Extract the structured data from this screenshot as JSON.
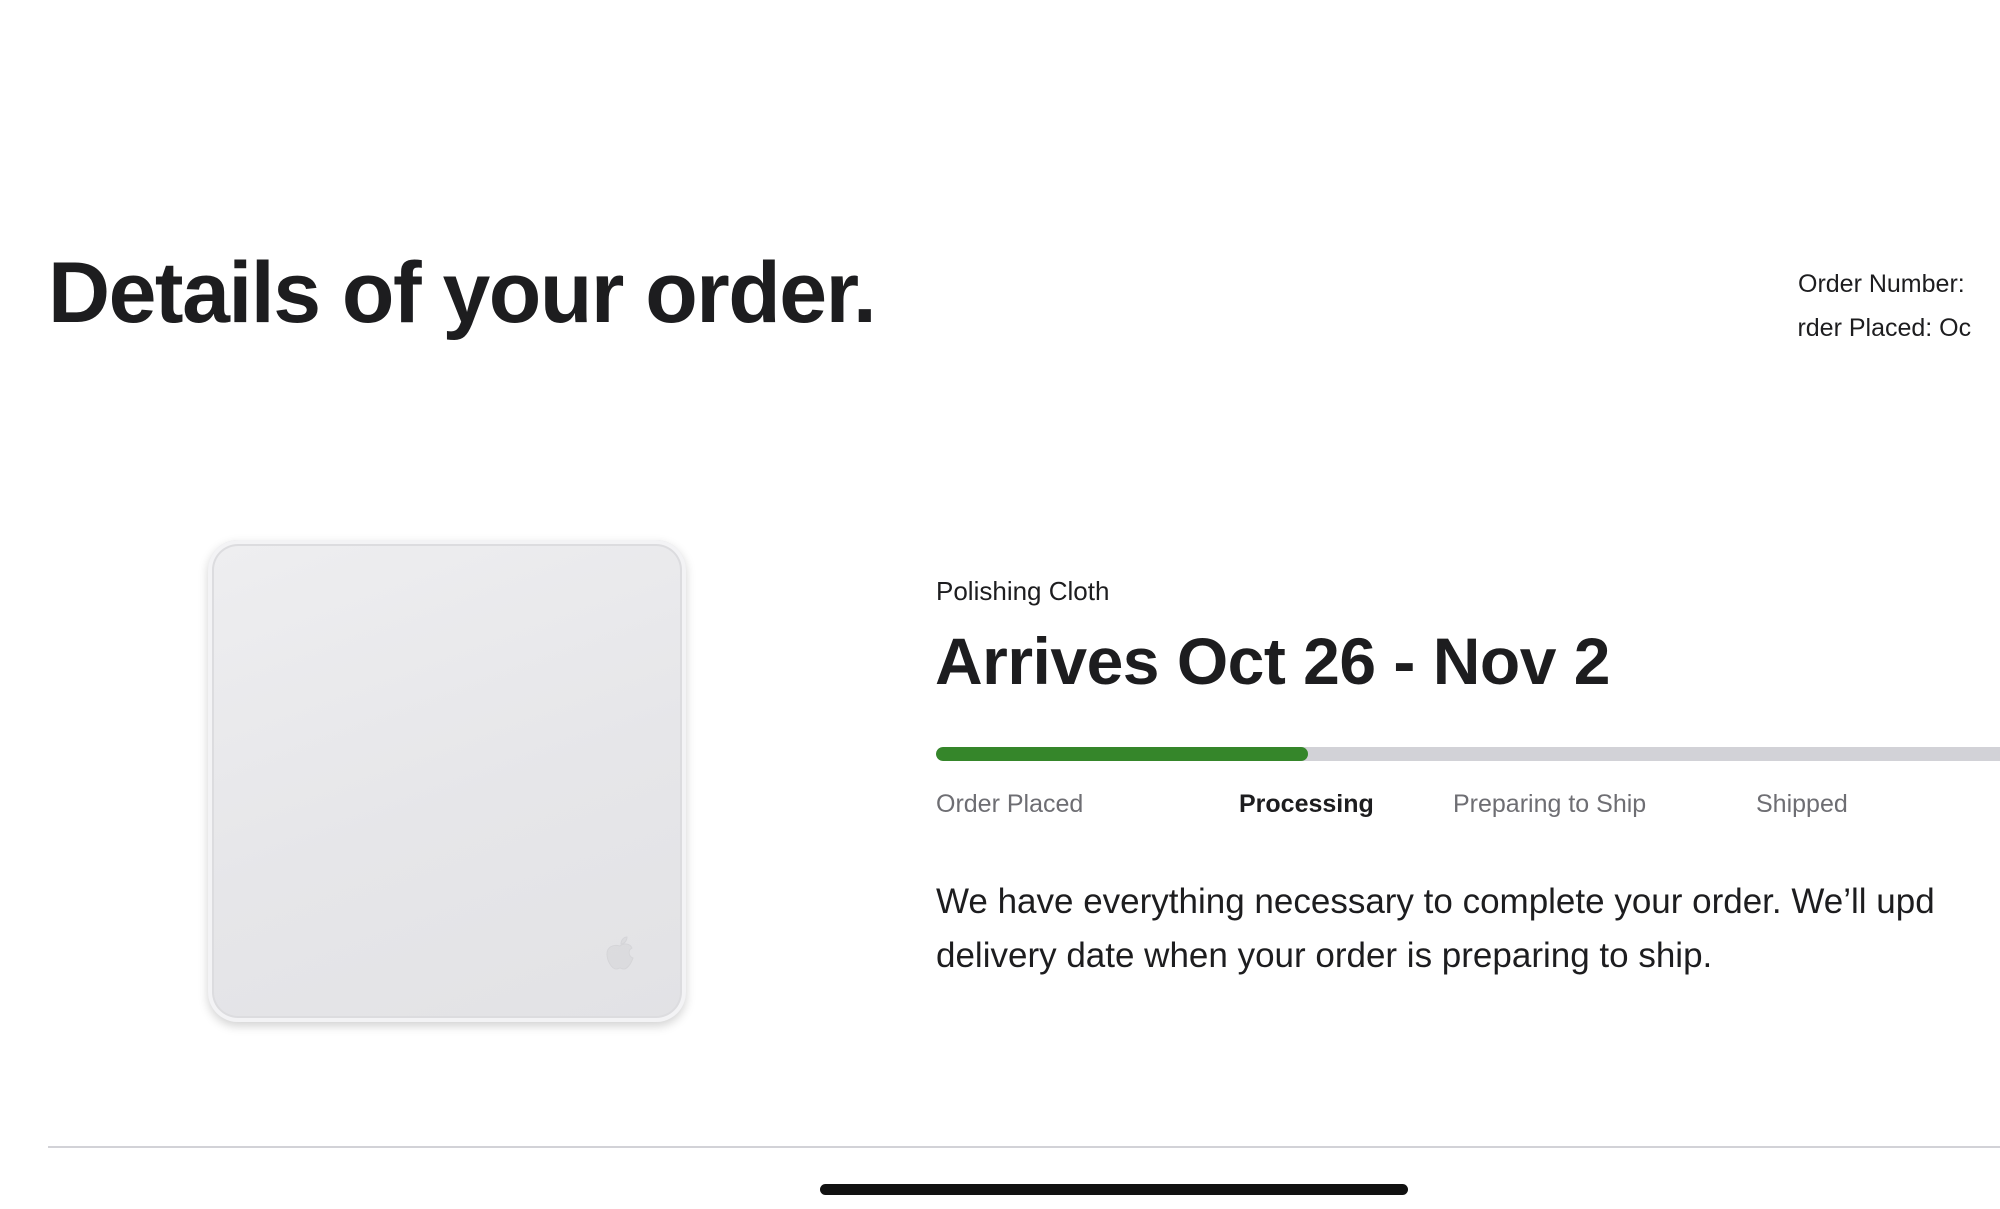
{
  "header": {
    "title": "Details of your order.",
    "order_number_label": "Order Number:",
    "order_placed_label": "Order Placed: Oc"
  },
  "item": {
    "name": "Polishing Cloth",
    "arrival": "Arrives Oct 26 - Nov 2",
    "image_icon": "apple-logo-icon"
  },
  "progress": {
    "fraction": 0.35,
    "fill_color": "#35862a",
    "track_color": "#d2d2d7",
    "current_step": "Processing",
    "steps": [
      "Order Placed",
      "Processing",
      "Preparing to Ship",
      "Shipped"
    ]
  },
  "status": {
    "message_line1": "We have everything necessary to complete your order. We’ll upd",
    "message_line2": "delivery date when your order is preparing to ship."
  }
}
